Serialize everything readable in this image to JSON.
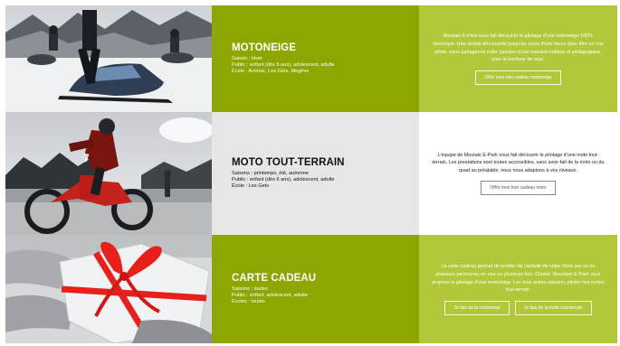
{
  "rows": [
    {
      "title": "MOTONEIGE",
      "meta": [
        "Saison : hiver",
        "Public : enfant (dès 5 ans), adolescent, adulte",
        "École : Avoriaz, Les Gets, Megève"
      ],
      "description": "Moutain E-Park vous fait découvrir le pilotage d'une motoneige 100% électrique. Une simple découverte jusqu'au cours d'une heure pour être un vrai pilote, nous partageons notre passion d'une manière ludique et pédagogique, pour le bonheur de tous.",
      "buttons": [
        "Offrir mon bon cadeau motoneige"
      ]
    },
    {
      "title": "MOTO TOUT-TERRAIN",
      "meta": [
        "Saisons : printemps, été, automne",
        "Public : enfant (dès 6 ans), adolescent, adulte",
        "École : Les Gets"
      ],
      "description": "L'équipe de Moutain E-Park vous fait découvrir le pilotage d'une moto tout-terrain. Les prestations sont toutes accessibles, sans avoir fait de la moto ou du quad au préalable, nous nous adaptons à vos niveaux.",
      "buttons": [
        "Offrir mon bon cadeau moto"
      ]
    },
    {
      "title": "CARTE CADEAU",
      "meta": [
        "Saisons : toutes",
        "Public : enfant, adolescent, adulte",
        "Écoles : toutes"
      ],
      "description": "La carte cadeau permet de profiter de l'activité de votre choix par un ou plusieurs personnes en une ou plusieurs fois. Choisir, Mountain E-Park vous propose le pilotage d'une motoneige. Les trois autres saisons, piloter nos motos tout-terrain.",
      "buttons": [
        "Je fais de la motoneige",
        "Je fais de la moto tout-terrain"
      ]
    }
  ],
  "colors": {
    "green_dark": "#8fa500",
    "green_light": "#b2c83a",
    "grey": "#e6e6e6",
    "ribbon_red": "#e8201c"
  },
  "images": [
    "snowmobile-riders-photo",
    "dirt-bike-rider-photo",
    "gift-box-hands-photo"
  ]
}
